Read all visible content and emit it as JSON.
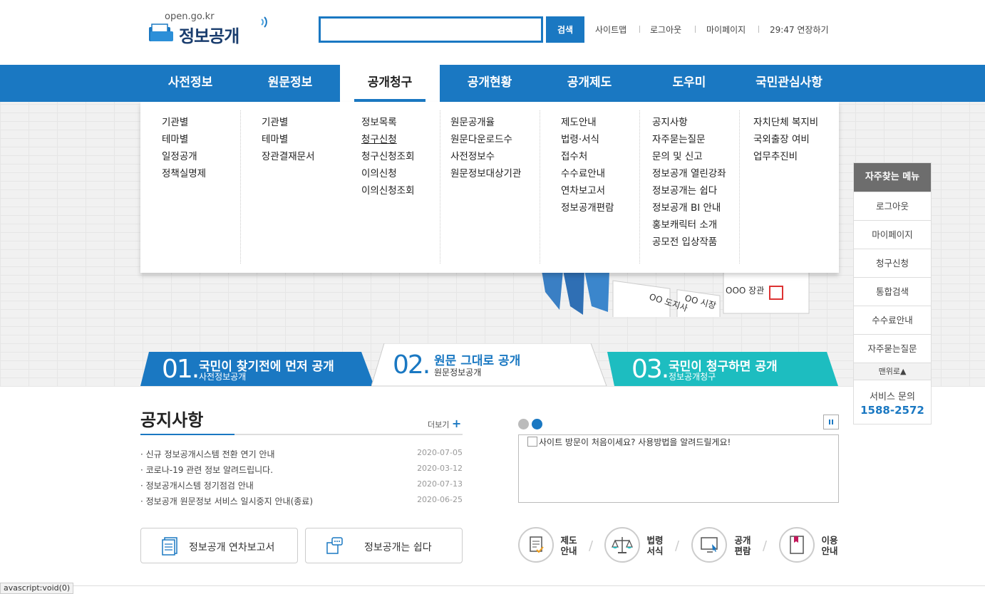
{
  "logo": {
    "url": "open.go.kr",
    "name": "정보공개"
  },
  "search": {
    "value": "",
    "button": "검색"
  },
  "util": [
    "사이트맵",
    "로그아웃",
    "마이페이지",
    "29:47 연장하기"
  ],
  "gnb": [
    "사전정보",
    "원문정보",
    "공개청구",
    "공개현황",
    "공개제도",
    "도우미",
    "국민관심사항"
  ],
  "menu": [
    [
      "기관별",
      "테마별",
      "일정공개",
      "정책실명제"
    ],
    [
      "기관별",
      "테마별",
      "장관결재문서"
    ],
    [
      "정보목록",
      "청구신청",
      "청구신청조회",
      "이의신청",
      "이의신청조회"
    ],
    [
      "원문공개율",
      "원문다운로드수",
      "사전정보수",
      "원문정보대상기관"
    ],
    [
      "제도안내",
      "법령·서식",
      "접수처",
      "수수료안내",
      "연차보고서",
      "정보공개편람"
    ],
    [
      "공지사항",
      "자주묻는질문",
      "문의 및 신고",
      "정보공개 열린강좌",
      "정보공개는 쉽다",
      "정보공개 BI 안내",
      "홍보캐릭터 소개",
      "공모전 입상작품"
    ],
    [
      "자치단체 복지비",
      "국외출장 여비",
      "업무추진비"
    ]
  ],
  "hero_image": {
    "labels": [
      "OO 도지사",
      "OO 시장",
      "OOO 장관"
    ]
  },
  "tabs": [
    {
      "num": "01.",
      "title": "국민이 찾기전에 먼저 공개",
      "sub": "사전정보공개"
    },
    {
      "num": "02.",
      "title": "원문 그대로 공개",
      "sub": "원문정보공개"
    },
    {
      "num": "03.",
      "title": "국민이 청구하면 공개",
      "sub": "정보공개청구"
    }
  ],
  "quick": {
    "title": "자주찾는 메뉴",
    "items": [
      "로그아웃",
      "마이페이지",
      "청구신청",
      "통합검색",
      "수수료안내",
      "자주묻는질문"
    ],
    "top": "맨위로",
    "contact_label": "서비스 문의",
    "phone": "1588-2572"
  },
  "notice": {
    "title": "공지사항",
    "more": "더보기",
    "items": [
      {
        "text": "신규 정보공개시스템 전환 연기 안내",
        "date": "2020-07-05"
      },
      {
        "text": "코로나-19 관련 정보 알려드립니다.",
        "date": "2020-03-12"
      },
      {
        "text": "정보공개시스템 정기점검 안내",
        "date": "2020-07-13"
      },
      {
        "text": "정보공개 원문정보 서비스 일시중지 안내(종료)",
        "date": "2020-06-25"
      }
    ]
  },
  "buttons": [
    "정보공개 연차보고서",
    "정보공개는 쉽다"
  ],
  "banner_alt": "사이트 방문이 처음이세요? 사용방법을 알려드릴게요!",
  "circles": [
    [
      "제도",
      "안내"
    ],
    [
      "법령",
      "서식"
    ],
    [
      "공개",
      "편람"
    ],
    [
      "이용",
      "안내"
    ]
  ],
  "status": "avascript:void(0)",
  "colors": {
    "primary": "#1a78c2",
    "tab1": "#1a78c2",
    "tab3": "#1dbdc0",
    "quick_title": "#6d6d6d"
  }
}
